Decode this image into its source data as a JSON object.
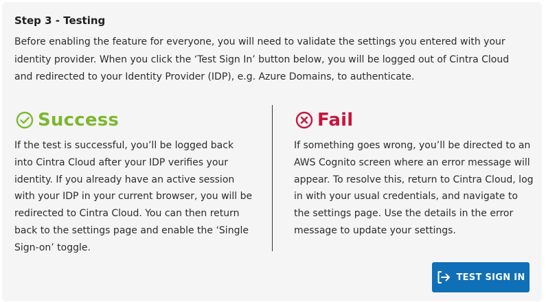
{
  "step": {
    "title": "Step 3 - Testing",
    "intro": "Before enabling the feature for everyone, you will need to validate the settings you entered with your identity provider. When you click the ‘Test Sign In’ button below, you will be logged out of Cintra Cloud and redirected to your Identity Provider (IDP), e.g. Azure Domains, to authenticate."
  },
  "success": {
    "icon": "check-circle-icon",
    "title": "Success",
    "text": "If the test is successful, you’ll be logged back into Cintra Cloud after your IDP verifies your identity. If you already have an active session with your IDP in your current browser, you will be redirected to Cintra Cloud. You can then return back to the settings page and enable the ‘Single Sign-on’ toggle."
  },
  "fail": {
    "icon": "x-circle-icon",
    "title": "Fail",
    "text": "If something goes wrong, you’ll be directed to an AWS Cognito screen where an error message will appear. To resolve this, return to Cintra Cloud, log in with your usual credentials, and navigate to the settings page. Use the details in the error message to update your settings."
  },
  "button": {
    "icon": "sign-in-icon",
    "label": "TEST SIGN IN"
  },
  "colors": {
    "success": "#7cb82f",
    "fail": "#c8143c",
    "button": "#0f6fb7",
    "panel": "#f5f5f5"
  }
}
